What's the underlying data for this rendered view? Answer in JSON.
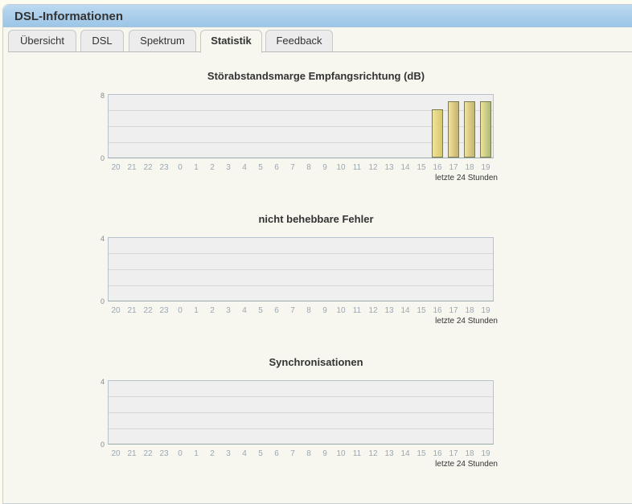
{
  "window": {
    "title": "DSL-Informationen"
  },
  "tabs": [
    {
      "label": "Übersicht"
    },
    {
      "label": "DSL"
    },
    {
      "label": "Spektrum"
    },
    {
      "label": "Statistik",
      "active": true
    },
    {
      "label": "Feedback"
    }
  ],
  "chart_data": [
    {
      "type": "bar",
      "title": "Störabstandsmarge Empfangsrichtung (dB)",
      "xlabel": "letzte 24 Stunden",
      "categories": [
        "20",
        "21",
        "22",
        "23",
        "0",
        "1",
        "2",
        "3",
        "4",
        "5",
        "6",
        "7",
        "8",
        "9",
        "10",
        "11",
        "12",
        "13",
        "14",
        "15",
        "16",
        "17",
        "18",
        "19"
      ],
      "values": [
        0,
        0,
        0,
        0,
        0,
        0,
        0,
        0,
        0,
        0,
        0,
        0,
        0,
        0,
        0,
        0,
        0,
        0,
        0,
        0,
        6,
        7,
        7,
        7
      ],
      "ylim": [
        0,
        8
      ],
      "yticks": [
        "0",
        "8"
      ],
      "grid": true,
      "colors": [
        "#d8c86a",
        "#c9b070",
        "#c8b372",
        "#a9ba78"
      ]
    },
    {
      "type": "bar",
      "title": "nicht behebbare Fehler",
      "xlabel": "letzte 24 Stunden",
      "categories": [
        "20",
        "21",
        "22",
        "23",
        "0",
        "1",
        "2",
        "3",
        "4",
        "5",
        "6",
        "7",
        "8",
        "9",
        "10",
        "11",
        "12",
        "13",
        "14",
        "15",
        "16",
        "17",
        "18",
        "19"
      ],
      "values": [
        0,
        0,
        0,
        0,
        0,
        0,
        0,
        0,
        0,
        0,
        0,
        0,
        0,
        0,
        0,
        0,
        0,
        0,
        0,
        0,
        0,
        0,
        0,
        0
      ],
      "ylim": [
        0,
        4
      ],
      "yticks": [
        "0",
        "4"
      ],
      "grid": true
    },
    {
      "type": "bar",
      "title": "Synchronisationen",
      "xlabel": "letzte 24 Stunden",
      "categories": [
        "20",
        "21",
        "22",
        "23",
        "0",
        "1",
        "2",
        "3",
        "4",
        "5",
        "6",
        "7",
        "8",
        "9",
        "10",
        "11",
        "12",
        "13",
        "14",
        "15",
        "16",
        "17",
        "18",
        "19"
      ],
      "values": [
        0,
        0,
        0,
        0,
        0,
        0,
        0,
        0,
        0,
        0,
        0,
        0,
        0,
        0,
        0,
        0,
        0,
        0,
        0,
        0,
        0,
        0,
        0,
        0
      ],
      "ylim": [
        0,
        4
      ],
      "yticks": [
        "0",
        "4"
      ],
      "grid": true
    }
  ]
}
